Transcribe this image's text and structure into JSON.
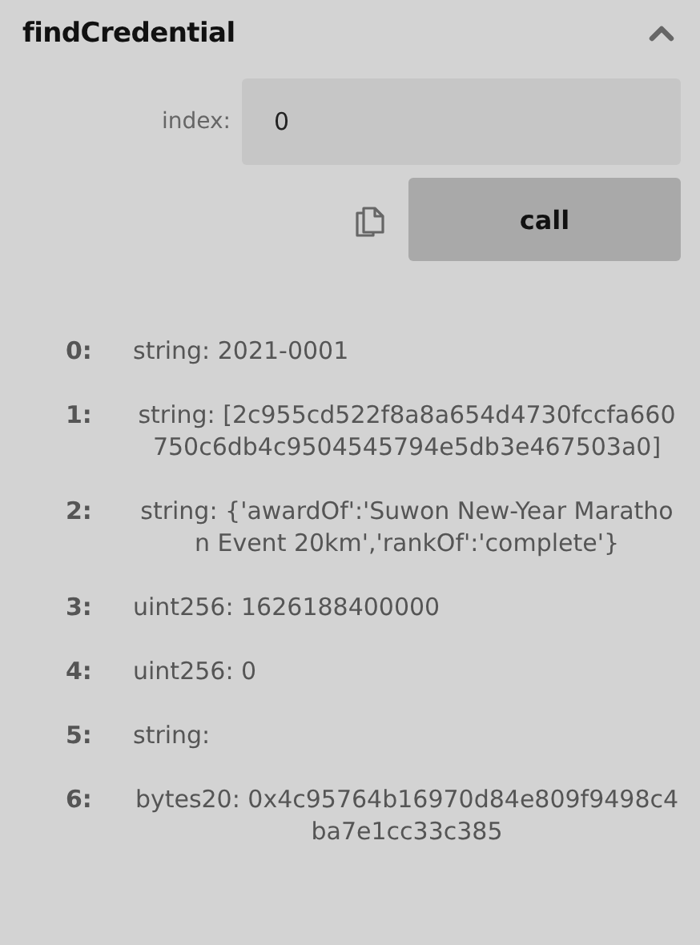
{
  "function": {
    "name": "findCredential",
    "expanded": true
  },
  "inputs": [
    {
      "label": "index:",
      "value": "0"
    }
  ],
  "call_button": "call",
  "outputs": [
    {
      "index": "0:",
      "value": "string: 2021-0001"
    },
    {
      "index": "1:",
      "value": "string: [2c955cd522f8a8a654d4730fccfa660750c6db4c9504545794e5db3e467503a0]"
    },
    {
      "index": "2:",
      "value": "string: {'awardOf':'Suwon New-Year Marathon Event 20km','rankOf':'complete'}"
    },
    {
      "index": "3:",
      "value": "uint256: 1626188400000"
    },
    {
      "index": "4:",
      "value": "uint256: 0"
    },
    {
      "index": "5:",
      "value": "string:"
    },
    {
      "index": "6:",
      "value": "bytes20: 0x4c95764b16970d84e809f9498c4ba7e1cc33c385"
    }
  ]
}
